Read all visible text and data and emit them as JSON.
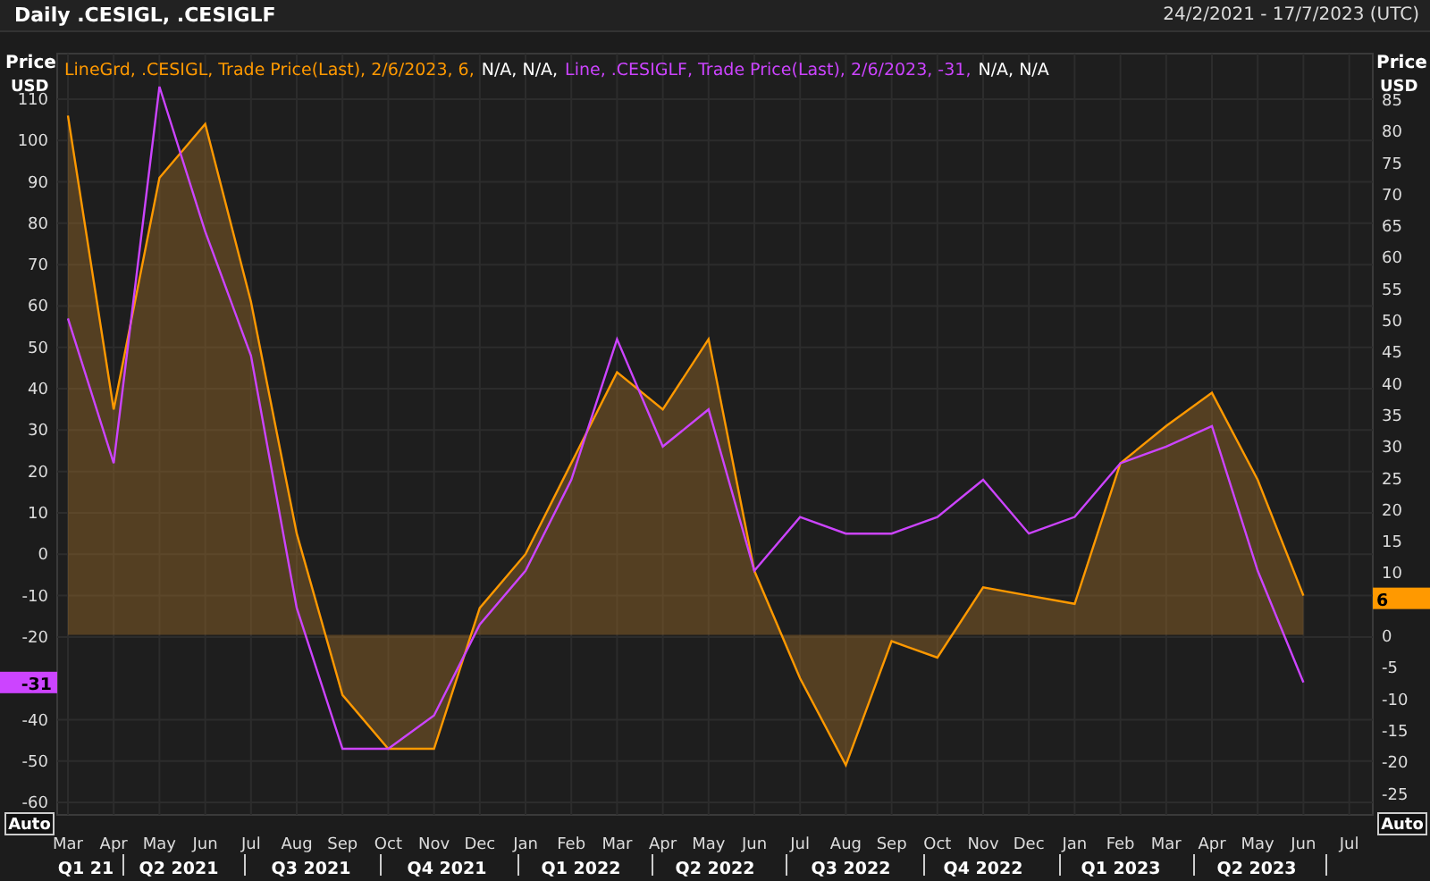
{
  "title": "Daily .CESIGL, .CESIGLF",
  "date_range": "24/2/2021 - 17/7/2023 (UTC)",
  "legend": [
    {
      "text": "LineGrd, .CESIGL, Trade Price(Last), 2/6/2023, 6,",
      "color": "#ff9900"
    },
    {
      "text": "N/A, N/A,",
      "color": "#ffffff"
    },
    {
      "text": "Line, .CESIGLF, Trade Price(Last), 2/6/2023, -31,",
      "color": "#cc44ff"
    },
    {
      "text": "N/A, N/A",
      "color": "#ffffff"
    }
  ],
  "left_axis": {
    "label": "Price",
    "unit": "USD",
    "badge": "-31",
    "auto": "Auto"
  },
  "right_axis": {
    "label": "Price",
    "unit": "USD",
    "badge": "6",
    "auto": "Auto",
    "ticks": [
      "85",
      "80",
      "75",
      "70",
      "65",
      "60",
      "55",
      "50",
      "45",
      "40",
      "35",
      "30",
      "25",
      "20",
      "15",
      "10",
      "0",
      "-5",
      "-10",
      "-15",
      "-20",
      "-25"
    ]
  },
  "chart_data": {
    "type": "line",
    "grid": true,
    "ylim": [
      -63,
      121
    ],
    "categories": [
      "Mar",
      "Apr",
      "May",
      "Jun",
      "Jul",
      "Aug",
      "Sep",
      "Oct",
      "Nov",
      "Dec",
      "Jan",
      "Feb",
      "Mar",
      "Apr",
      "May",
      "Jun",
      "Jul",
      "Aug",
      "Sep",
      "Oct",
      "Nov",
      "Dec",
      "Jan",
      "Feb",
      "Mar",
      "Apr",
      "May",
      "Jun",
      "Jul"
    ],
    "yticks": [
      110,
      100,
      90,
      80,
      70,
      60,
      50,
      40,
      30,
      20,
      10,
      0,
      -10,
      -20,
      -40,
      -50,
      -60
    ],
    "series": [
      {
        "color": "#ff9900",
        "values": [
          106,
          35,
          91,
          104,
          61,
          5,
          -34,
          -47,
          -47,
          -13,
          0,
          22,
          44,
          35,
          52,
          -4,
          -30,
          -51,
          -21,
          -25,
          -8,
          -10,
          -12,
          22,
          31,
          39,
          18,
          -10,
          null
        ]
      },
      {
        "color": "#cc44ff",
        "values": [
          57,
          22,
          113,
          78,
          48,
          -13,
          -47,
          -47,
          -39,
          -17,
          -4,
          18,
          52,
          26,
          35,
          -4,
          9,
          5,
          5,
          9,
          18,
          5,
          9,
          22,
          26,
          31,
          -4,
          -31,
          null
        ]
      }
    ]
  },
  "quarters": [
    "Q1 21",
    "Q2 2021",
    "Q3 2021",
    "Q4 2021",
    "Q1 2022",
    "Q2 2022",
    "Q3 2022",
    "Q4 2022",
    "Q1 2023",
    "Q2 2023"
  ]
}
